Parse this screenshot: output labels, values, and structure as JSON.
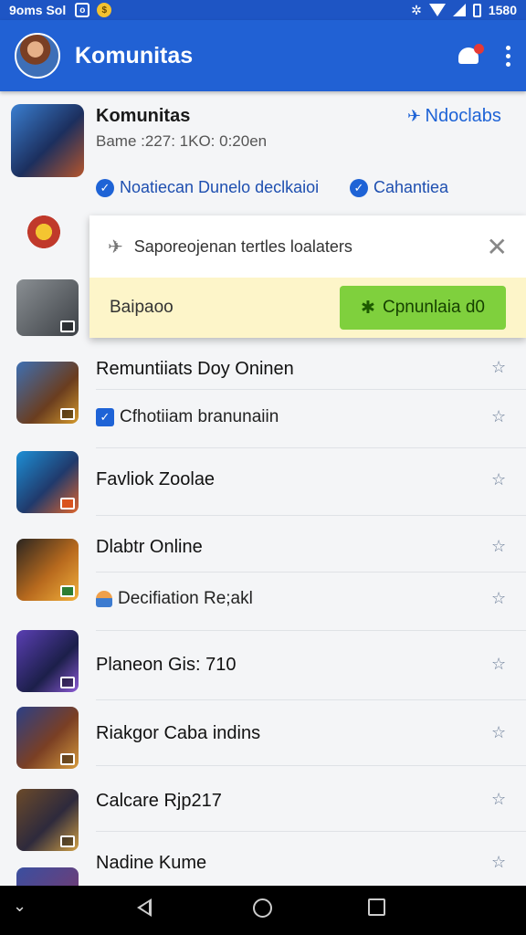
{
  "status_bar": {
    "carrier": "9oms Sol",
    "time": "1580"
  },
  "app_bar": {
    "title": "Komunitas"
  },
  "header": {
    "title": "Komunitas",
    "subtitle": "Bame :227: 1KO: 0:20en",
    "link": "Ndoclabs",
    "tag1": "Noatiecan Dunelo declkaioi",
    "tag2": "Cahantiea"
  },
  "popup": {
    "message": "Saporeojenan tertles loalaters",
    "label": "Baipaoo",
    "button": "Cpnunlaia d0"
  },
  "list": [
    {
      "title": "Remuntiiats Doy Oninen",
      "sub": "Cfhotiiam  branunaiin"
    },
    {
      "title": "Favliok Zoolae"
    },
    {
      "title": "Dlabtr Online",
      "sub": "Decifiation Re;akl"
    },
    {
      "title": "Planeon Gis: 710"
    },
    {
      "title": "Riakgor Caba indins"
    },
    {
      "title": "Calcare Rjp217"
    },
    {
      "title": "Nadine Kume"
    }
  ],
  "colors": {
    "appbar": "#2161d4",
    "accent": "#1e63d6",
    "green": "#7fd03d",
    "popup_bar": "#fdf5c9"
  }
}
